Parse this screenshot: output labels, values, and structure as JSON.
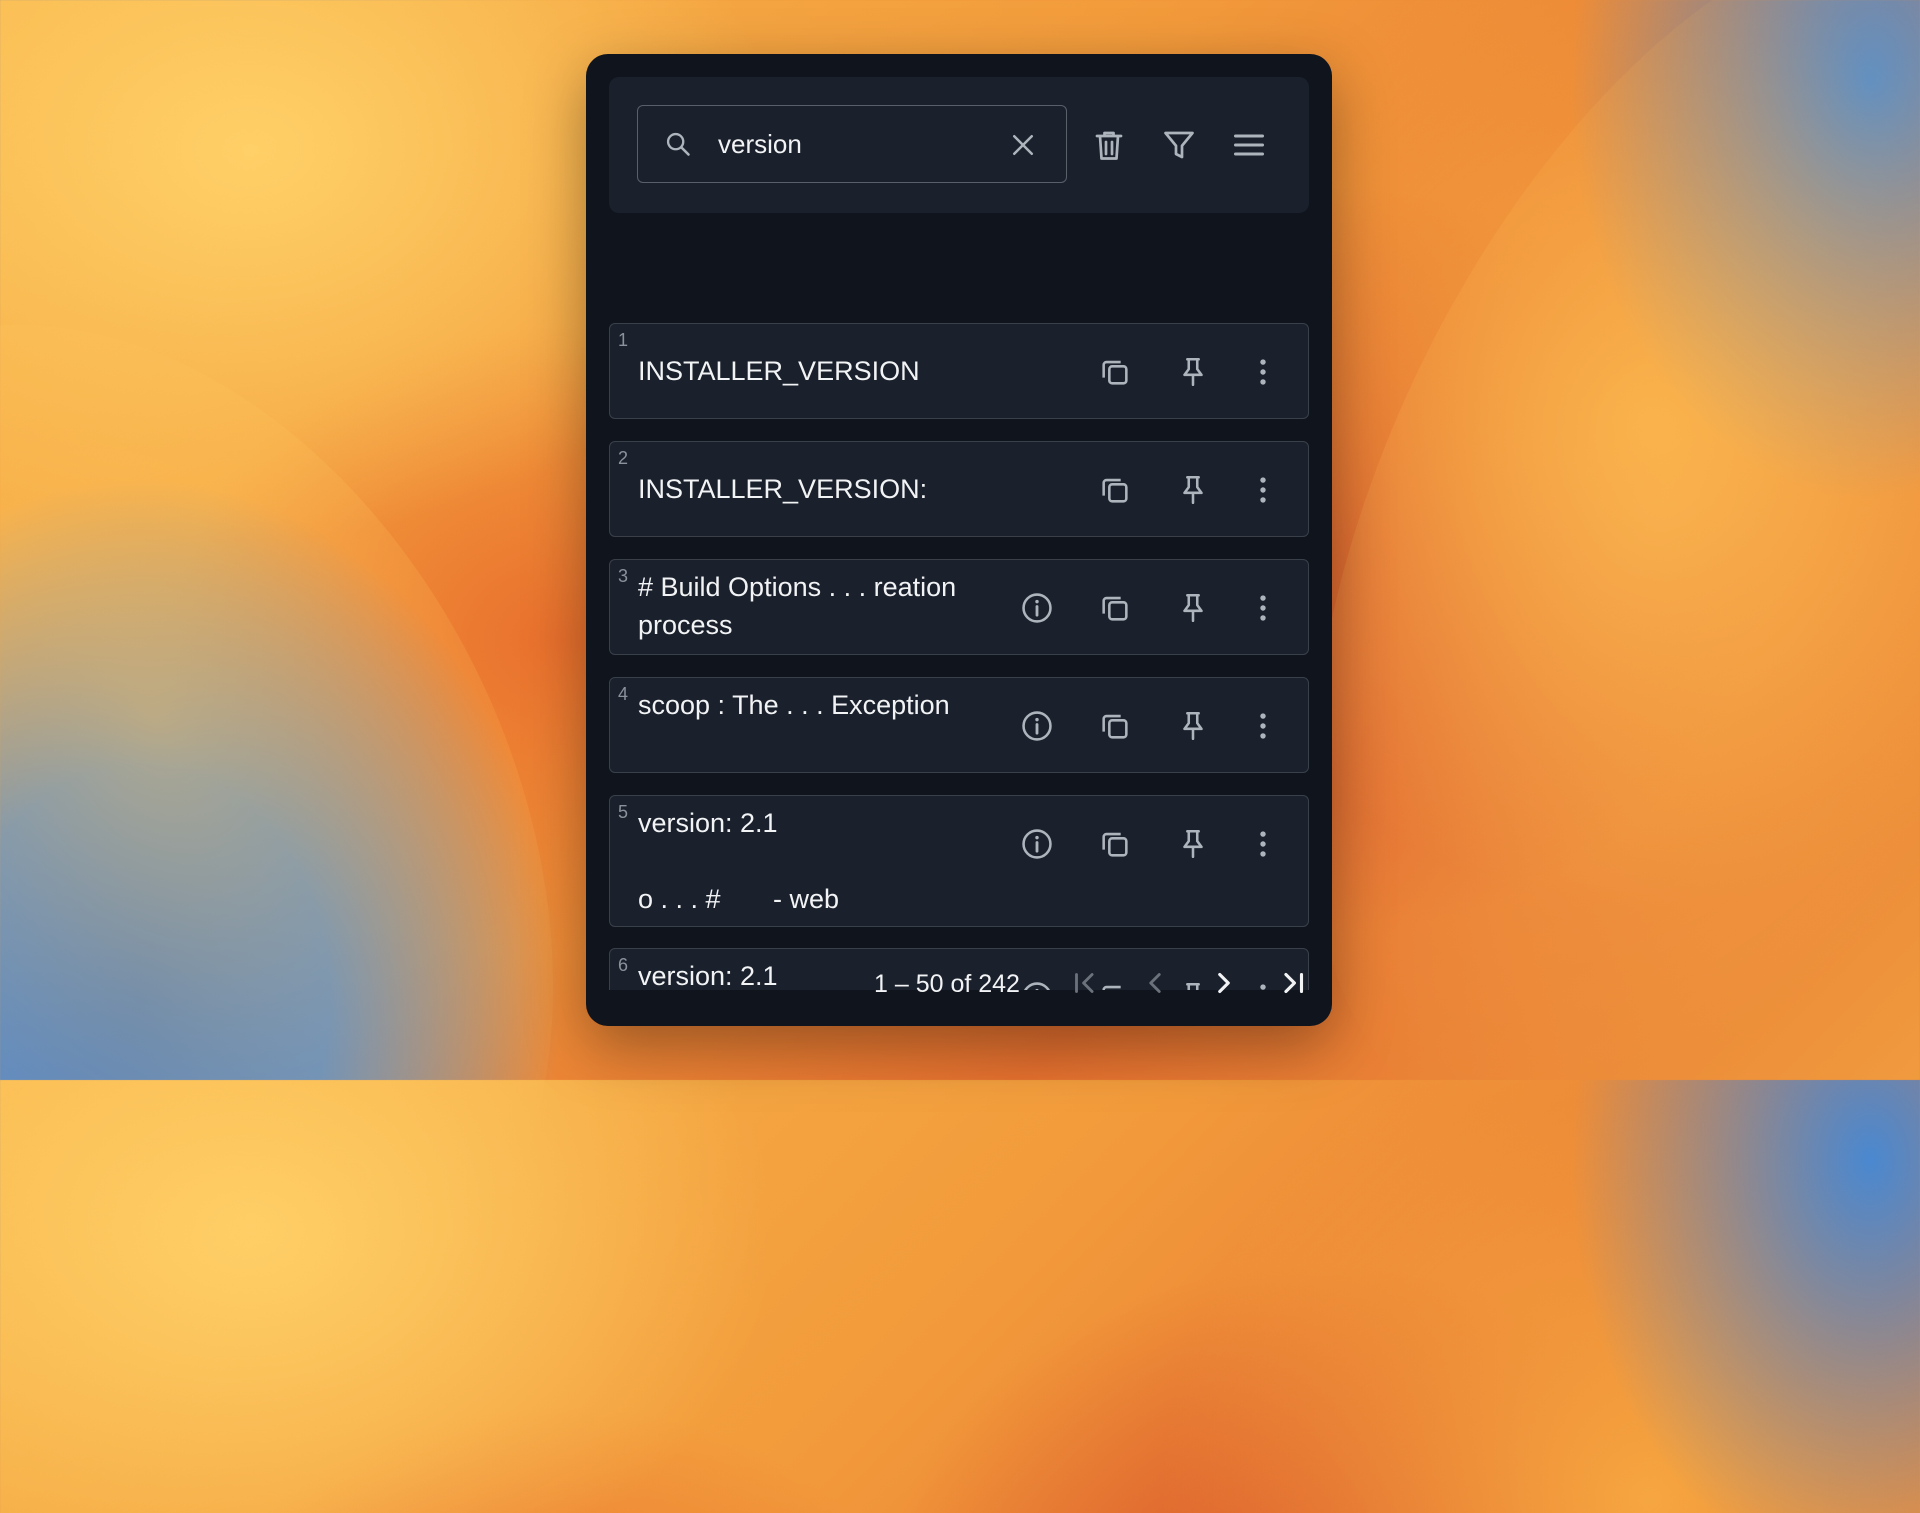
{
  "search": {
    "value": "version",
    "placeholder": ""
  },
  "toolbar": {
    "icons": [
      "trash-icon",
      "filter-icon",
      "menu-icon"
    ]
  },
  "items": [
    {
      "index": "1",
      "line1": "INSTALLER_VERSION",
      "line2": "",
      "line3": "",
      "has_info": false
    },
    {
      "index": "2",
      "line1": "INSTALLER_VERSION:",
      "line2": "",
      "line3": "",
      "has_info": false
    },
    {
      "index": "3",
      "line1": "# Build Options . . . reation",
      "line2": "process",
      "line3": "",
      "has_info": true
    },
    {
      "index": "4",
      "line1": "scoop : The . . . Exception",
      "line2": "",
      "line3": "",
      "has_info": true
    },
    {
      "index": "5",
      "line1": "version: 2.1",
      "line2": "",
      "line3": "o . . . #       - web",
      "has_info": true
    },
    {
      "index": "6",
      "line1": "version: 2.1",
      "line2": "",
      "line3": "",
      "has_info": true
    }
  ],
  "pagination": {
    "label": "1 – 50 of 242"
  },
  "colors": {
    "panel": "#0f141d",
    "card": "#1a212c",
    "text": "#f2f3f5",
    "icon": "#aeb4bc"
  }
}
